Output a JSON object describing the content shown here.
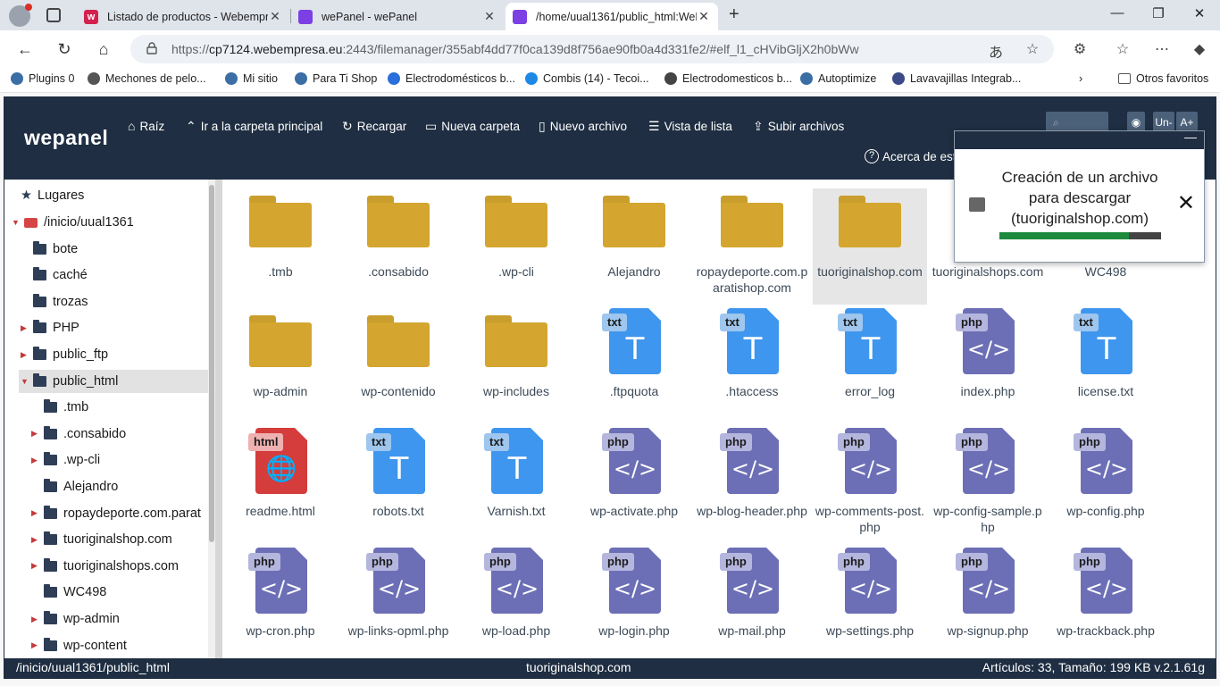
{
  "browser": {
    "tabs": [
      {
        "title": "Listado de productos - Webempre",
        "favicon": "webempresa-icon",
        "color": "#d3214d",
        "letter": "w"
      },
      {
        "title": "wePanel - wePanel",
        "favicon": "wepanel-icon",
        "color": "#7b3fe4",
        "letter": ""
      },
      {
        "title": "/home/uual1361/public_html:WeP",
        "favicon": "wepanel-icon",
        "color": "#7b3fe4",
        "letter": ""
      }
    ],
    "url_prefix": "https://",
    "url_host": "cp7124.webempresa.eu",
    "url_rest": ":2443/filemanager/355abf4dd77f0ca139d8f756ae90fb0a4d331fe2/#elf_l1_cHVibGljX2h0bWw",
    "bookmarks": [
      {
        "label": "Plugins 0",
        "color": "#3b6ea5"
      },
      {
        "label": "Mechones de pelo...",
        "color": "#555555"
      },
      {
        "label": "Mi sitio",
        "color": "#3b6ea5"
      },
      {
        "label": "Para Ti Shop",
        "color": "#3b6ea5"
      },
      {
        "label": "Electrodomésticos b...",
        "color": "#2a6fdb"
      },
      {
        "label": "Combis (14) - Tecoi...",
        "color": "#1e88e5"
      },
      {
        "label": "Electrodomesticos b...",
        "color": "#444444"
      },
      {
        "label": "Autoptimize",
        "color": "#3b6ea5"
      },
      {
        "label": "Lavavajillas Integrab...",
        "color": "#3c4a88"
      }
    ],
    "other_favorites": "Otros favoritos"
  },
  "app": {
    "logo": "wepanel",
    "nav": [
      {
        "label": "Raíz",
        "icon": "home-icon",
        "glyph": "⌂"
      },
      {
        "label": "Ir a la carpeta principal",
        "icon": "up-icon",
        "glyph": "⌃"
      },
      {
        "label": "Recargar",
        "icon": "reload-icon",
        "glyph": "↻"
      },
      {
        "label": "Nueva carpeta",
        "icon": "folder-icon",
        "glyph": "▭"
      },
      {
        "label": "Nuevo archivo",
        "icon": "file-icon",
        "glyph": "▯"
      },
      {
        "label": "Vista de lista",
        "icon": "list-icon",
        "glyph": "☰"
      },
      {
        "label": "Subir archivos",
        "icon": "upload-icon",
        "glyph": "⇪"
      }
    ],
    "about": "Acerca de est",
    "font_down": "Un-",
    "font_up": "A+",
    "search_placeholder": "⌕"
  },
  "sidebar": {
    "places": "Lugares",
    "items": [
      {
        "label": "/inicio/uual1361",
        "level": 0,
        "arrow": "▼"
      },
      {
        "label": "bote",
        "level": 1,
        "arrow": ""
      },
      {
        "label": "caché",
        "level": 1,
        "arrow": ""
      },
      {
        "label": "trozas",
        "level": 1,
        "arrow": ""
      },
      {
        "label": "PHP",
        "level": 1,
        "arrow": "▶"
      },
      {
        "label": "public_ftp",
        "level": 1,
        "arrow": "▶"
      },
      {
        "label": "public_html",
        "level": 1,
        "arrow": "▼"
      },
      {
        "label": ".tmb",
        "level": 2,
        "arrow": ""
      },
      {
        "label": ".consabido",
        "level": 2,
        "arrow": "▶"
      },
      {
        "label": ".wp-cli",
        "level": 2,
        "arrow": "▶"
      },
      {
        "label": "Alejandro",
        "level": 2,
        "arrow": ""
      },
      {
        "label": "ropaydeporte.com.parat",
        "level": 2,
        "arrow": "▶"
      },
      {
        "label": "tuoriginalshop.com",
        "level": 2,
        "arrow": "▶"
      },
      {
        "label": "tuoriginalshops.com",
        "level": 2,
        "arrow": "▶"
      },
      {
        "label": "WC498",
        "level": 2,
        "arrow": ""
      },
      {
        "label": "wp-admin",
        "level": 2,
        "arrow": "▶"
      },
      {
        "label": "wp-content",
        "level": 2,
        "arrow": "▶"
      }
    ]
  },
  "files": [
    {
      "name": ".tmb",
      "type": "folder"
    },
    {
      "name": ".consabido",
      "type": "folder"
    },
    {
      "name": ".wp-cli",
      "type": "folder"
    },
    {
      "name": "Alejandro",
      "type": "folder"
    },
    {
      "name": "ropaydeporte.com.paratishop.com",
      "type": "folder"
    },
    {
      "name": "tuoriginalshop.com",
      "type": "folder",
      "selected": true
    },
    {
      "name": "tuoriginalshops.com",
      "type": "folder"
    },
    {
      "name": "WC498",
      "type": "folder"
    },
    {
      "name": "wp-admin",
      "type": "folder"
    },
    {
      "name": "wp-contenido",
      "type": "folder"
    },
    {
      "name": "wp-includes",
      "type": "folder"
    },
    {
      "name": ".ftpquota",
      "type": "txt"
    },
    {
      "name": ".htaccess",
      "type": "txt"
    },
    {
      "name": "error_log",
      "type": "txt"
    },
    {
      "name": "index.php",
      "type": "php"
    },
    {
      "name": "license.txt",
      "type": "txt"
    },
    {
      "name": "readme.html",
      "type": "html"
    },
    {
      "name": "robots.txt",
      "type": "txt"
    },
    {
      "name": "Varnish.txt",
      "type": "txt"
    },
    {
      "name": "wp-activate.php",
      "type": "php"
    },
    {
      "name": "wp-blog-header.php",
      "type": "php"
    },
    {
      "name": "wp-comments-post.php",
      "type": "php"
    },
    {
      "name": "wp-config-sample.php",
      "type": "php"
    },
    {
      "name": "wp-config.php",
      "type": "php"
    },
    {
      "name": "wp-cron.php",
      "type": "php"
    },
    {
      "name": "wp-links-opml.php",
      "type": "php"
    },
    {
      "name": "wp-load.php",
      "type": "php"
    },
    {
      "name": "wp-login.php",
      "type": "php"
    },
    {
      "name": "wp-mail.php",
      "type": "php"
    },
    {
      "name": "wp-settings.php",
      "type": "php"
    },
    {
      "name": "wp-signup.php",
      "type": "php"
    },
    {
      "name": "wp-trackback.php",
      "type": "php"
    }
  ],
  "dialog": {
    "message": "Creación de un archivo para descargar (tuoriginalshop.com)",
    "progress": 0.8
  },
  "status": {
    "path": "/inicio/uual1361/public_html",
    "selected": "tuoriginalshop.com",
    "summary": "Artículos: 33, Tamaño: 199 KB v.2.1.61g"
  }
}
